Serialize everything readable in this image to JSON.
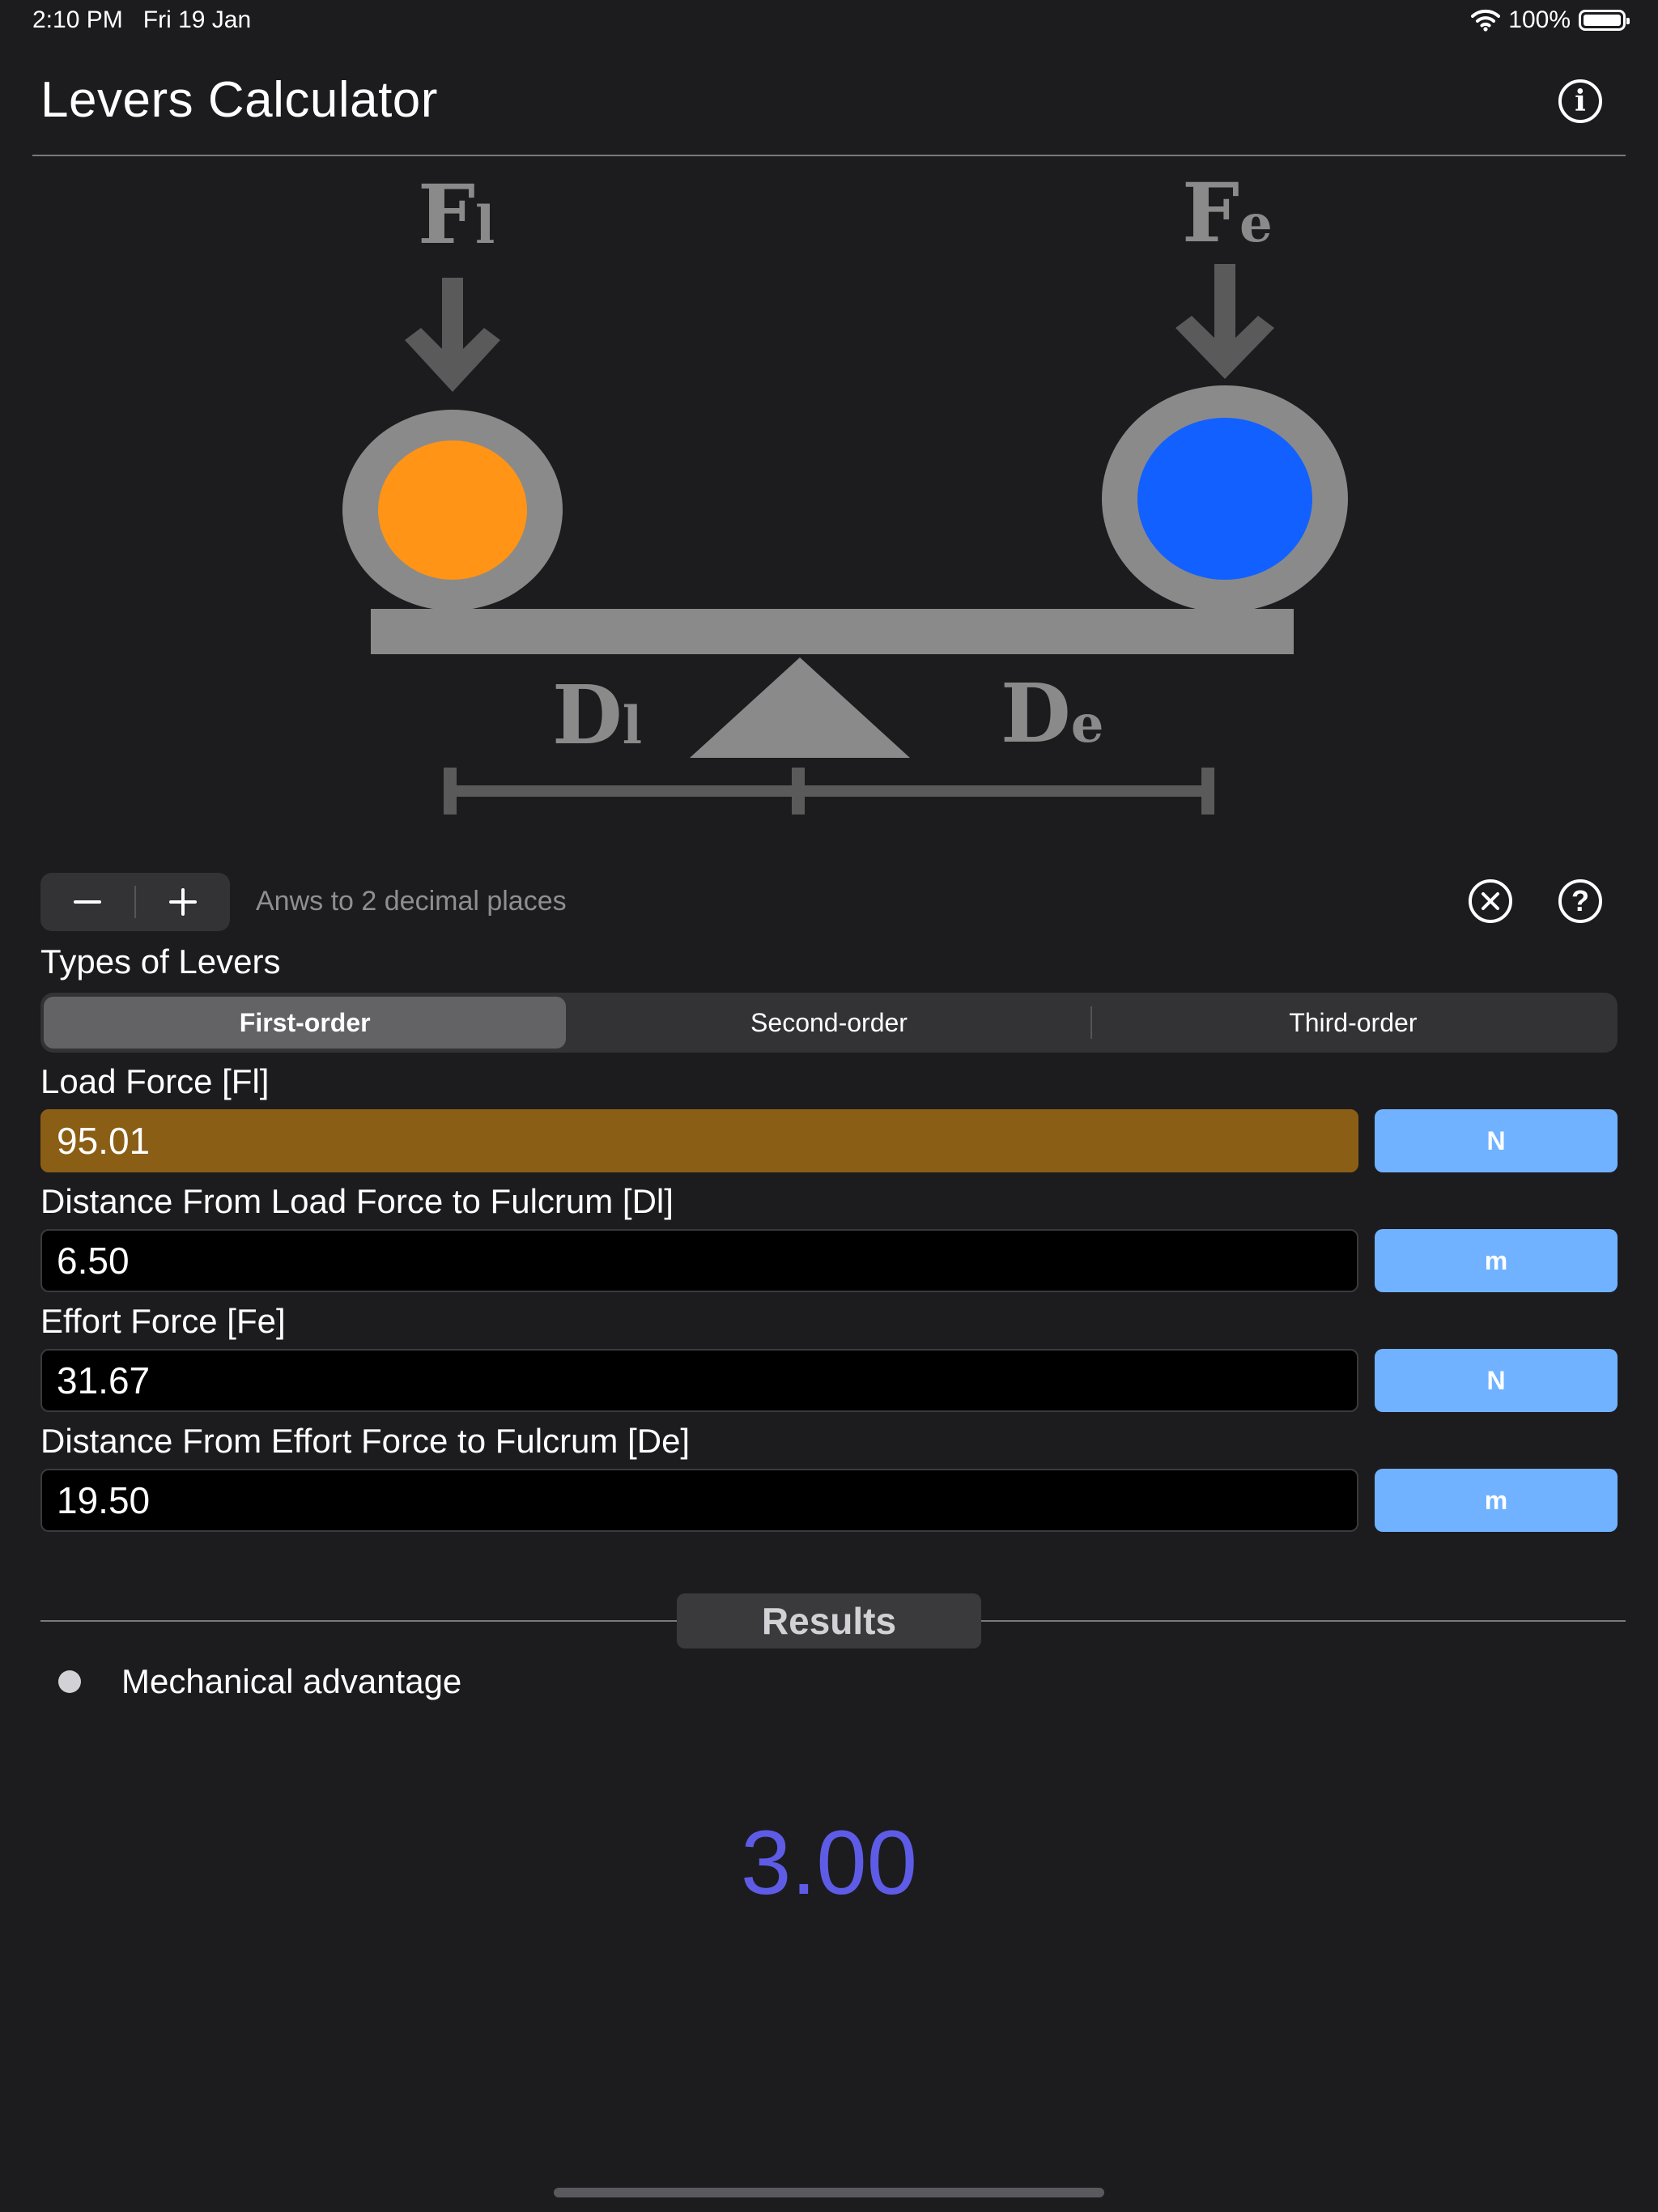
{
  "status_bar": {
    "time": "2:10 PM",
    "date": "Fri 19 Jan",
    "battery": "100%"
  },
  "header": {
    "title": "Levers Calculator",
    "info_icon": "info-icon"
  },
  "diagram": {
    "load_force_symbol": "F",
    "load_force_sub": "l",
    "effort_force_symbol": "F",
    "effort_force_sub": "e",
    "load_distance_symbol": "D",
    "load_distance_sub": "l",
    "effort_distance_symbol": "D",
    "effort_distance_sub": "e",
    "load_color": "#ff9416",
    "effort_color": "#1260ff"
  },
  "precision": {
    "label": "Anws to 2 decimal places",
    "decrement_icon": "minus-icon",
    "increment_icon": "plus-icon"
  },
  "lever_types": {
    "label": "Types of Levers",
    "options": [
      "First-order",
      "Second-order",
      "Third-order"
    ],
    "selected": "First-order"
  },
  "inputs": [
    {
      "label": "Load Force [Fl]",
      "value": "95.01",
      "unit": "N",
      "active": true
    },
    {
      "label": "Distance From Load Force to Fulcrum [Dl]",
      "value": "6.50",
      "unit": "m",
      "active": false
    },
    {
      "label": "Effort Force [Fe]",
      "value": "31.67",
      "unit": "N",
      "active": false
    },
    {
      "label": "Distance From Effort Force to Fulcrum [De]",
      "value": "19.50",
      "unit": "m",
      "active": false
    }
  ],
  "results": {
    "title": "Results",
    "name": "Mechanical advantage",
    "value": "3.00",
    "value_color": "#5e5ce6"
  },
  "colors": {
    "accent_unit": "#70b2ff",
    "active_field": "#8b5e15",
    "background": "#1c1c1e"
  }
}
